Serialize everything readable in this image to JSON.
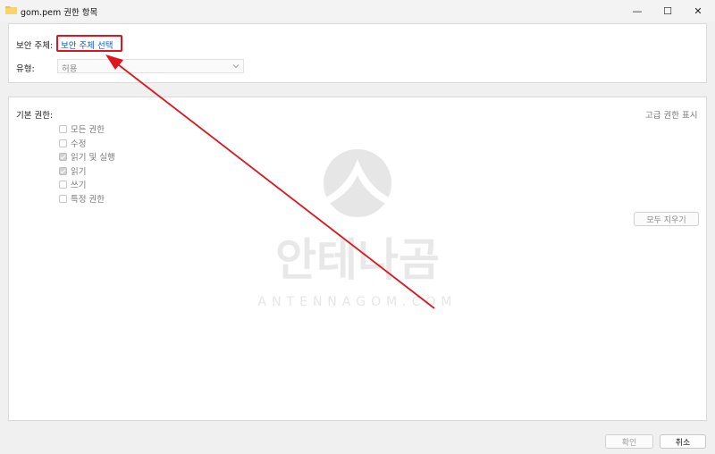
{
  "window": {
    "title": "gom.pem 권한 항목",
    "minimize": "—",
    "maximize": "☐",
    "close": "✕"
  },
  "principal": {
    "label": "보안 주체:",
    "link": "보안 주체 선택"
  },
  "type": {
    "label": "유형:",
    "value": "허용"
  },
  "permissions": {
    "label": "기본 권한:",
    "advanced_link": "고급 권한 표시",
    "items": [
      {
        "label": "모든 권한",
        "checked": false
      },
      {
        "label": "수정",
        "checked": false
      },
      {
        "label": "읽기 및 실행",
        "checked": true
      },
      {
        "label": "읽기",
        "checked": true
      },
      {
        "label": "쓰기",
        "checked": false
      },
      {
        "label": "특정 권한",
        "checked": false
      }
    ],
    "clear_all": "모두 지우기"
  },
  "footer": {
    "ok": "확인",
    "cancel": "취소"
  },
  "watermark": {
    "text_ko": "안테나곰",
    "text_en": "ANTENNAGOM.COM"
  },
  "colors": {
    "annotation": "#e0141e",
    "link": "#0a5fc8"
  }
}
